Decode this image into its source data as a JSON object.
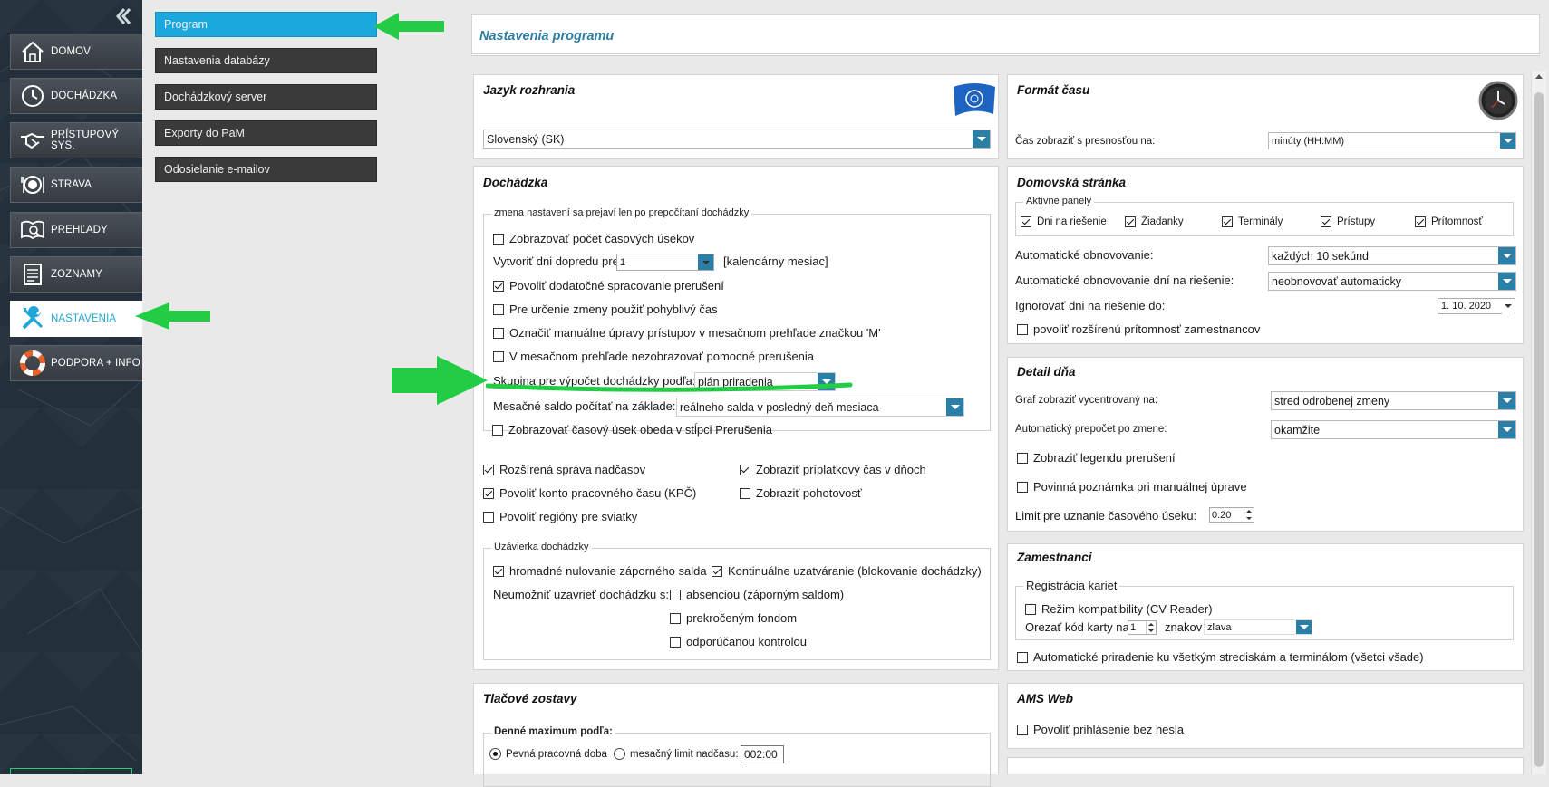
{
  "nav": {
    "items": [
      {
        "label": "DOMOV",
        "icon": "home-icon"
      },
      {
        "label": "DOCHÁDZKA",
        "icon": "clock-icon"
      },
      {
        "label": "PRÍSTUPOVÝ SYS.",
        "icon": "handshake-icon"
      },
      {
        "label": "STRAVA",
        "icon": "dining-icon"
      },
      {
        "label": "PREHĽADY",
        "icon": "book-search-icon"
      },
      {
        "label": "ZOZNAMY",
        "icon": "list-icon"
      },
      {
        "label": "NASTAVENIA",
        "icon": "tools-icon",
        "active": true
      },
      {
        "label": "PODPORA + INFO",
        "icon": "lifebuoy-icon"
      }
    ]
  },
  "submenu": {
    "items": [
      {
        "label": "Program",
        "active": true
      },
      {
        "label": "Nastavenia databázy"
      },
      {
        "label": "Dochádzkový server"
      },
      {
        "label": "Exporty do PaM"
      },
      {
        "label": "Odosielanie e-mailov"
      }
    ]
  },
  "header": {
    "title": "Nastavenia programu"
  },
  "language": {
    "title": "Jazyk rozhrania",
    "value": "Slovenský (SK)"
  },
  "time_format": {
    "title": "Formát času",
    "label": "Čas zobraziť s presnosťou na:",
    "value": "minúty (HH:MM)"
  },
  "attendance": {
    "title": "Dochádzka",
    "fieldset_legend": "zmena nastavení sa prejaví len po prepočítaní dochádzky",
    "show_segments": "Zobrazovať počet časových úsekov",
    "create_days_prefix": "Vytvoriť dni dopredu pre",
    "create_days_value": "1",
    "create_days_suffix": "[kalendárny mesiac]",
    "allow_processing": "Povoliť dodatočné spracovanie prerušení",
    "flexible_time": "Pre určenie zmeny použiť pohyblivý čas",
    "mark_manual": "Označiť manuálne úpravy prístupov v mesačnom prehľade značkou 'M'",
    "hide_breaks": "V mesačnom prehľade nezobrazovať pomocné prerušenia",
    "group_label": "Skupina pre výpočet dochádzky podľa:",
    "group_value": "plán priradenia",
    "saldo_label": "Mesačné saldo počítať na základe:",
    "saldo_value": "reálneho salda v posledný deň mesiaca",
    "lunch_column": "Zobrazovať časový úsek obeda v stĺpci Prerušenia",
    "overtime": "Rozšírená správa nadčasov",
    "surcharge": "Zobraziť príplatkový čas v dňoch",
    "kpc": "Povoliť konto pracovného času (KPČ)",
    "standby": "Zobraziť pohotovosť",
    "regions": "Povoliť regióny pre sviatky",
    "closing_legend": "Uzávierka dochádzky",
    "mass_reset": "hromadné nulovanie záporného salda",
    "continuous": "Kontinuálne uzatváranie (blokovanie dochádzky)",
    "disallow_label": "Neumožniť uzavrieť dochádzku s:",
    "absence": "absenciou (záporným saldom)",
    "exceeded": "prekročeným fondom",
    "recommended": "odporúčanou kontrolou"
  },
  "home_page": {
    "title": "Domovská stránka",
    "panels_legend": "Aktívne panely",
    "panels": [
      "Dni na riešenie",
      "Žiadanky",
      "Terminály",
      "Prístupy",
      "Prítomnosť"
    ],
    "auto_refresh_label": "Automatické obnovovanie:",
    "auto_refresh_value": "každých 10 sekúnd",
    "auto_refresh_days_label": "Automatické obnovovanie dní na riešenie:",
    "auto_refresh_days_value": "neobnovovať automaticky",
    "ignore_label": "Ignorovať dni na riešenie do:",
    "ignore_value": "1. 10. 2020",
    "extended_presence": "povoliť rozšírenú prítomnosť zamestnancov"
  },
  "day_detail": {
    "title": "Detail dňa",
    "graph_label": "Graf zobraziť vycentrovaný na:",
    "graph_value": "stred odrobenej zmeny",
    "recalc_label": "Automatický prepočet po zmene:",
    "recalc_value": "okamžite",
    "legend_breaks": "Zobraziť legendu prerušení",
    "mandatory_note": "Povinná poznámka pri manuálnej úprave",
    "limit_label": "Limit pre uznanie časového úseku:",
    "limit_value": "0:20"
  },
  "employees": {
    "title": "Zamestnanci",
    "cards_legend": "Registrácia kariet",
    "compat_mode": "Režim kompatibility (CV Reader)",
    "trim_prefix": "Orezať kód karty na",
    "trim_value": "1",
    "trim_unit": "znakov",
    "trim_direction": "zľava",
    "auto_assign": "Automatické priradenie ku všetkým strediskám a terminálom (všetci všade)"
  },
  "print": {
    "title": "Tlačové zostavy",
    "daily_max_legend": "Denné maximum podľa:",
    "fixed_time": "Pevná pracovná doba",
    "monthly_limit": "mesačný limit nadčasu:",
    "limit_value": "002:00"
  },
  "ams_web": {
    "title": "AMS Web",
    "login_without_password": "Povoliť prihlásenie bez hesla"
  },
  "colors": {
    "accent": "#1ba8dc",
    "annotation": "#22cc44",
    "nav_bg": "#23303b"
  }
}
